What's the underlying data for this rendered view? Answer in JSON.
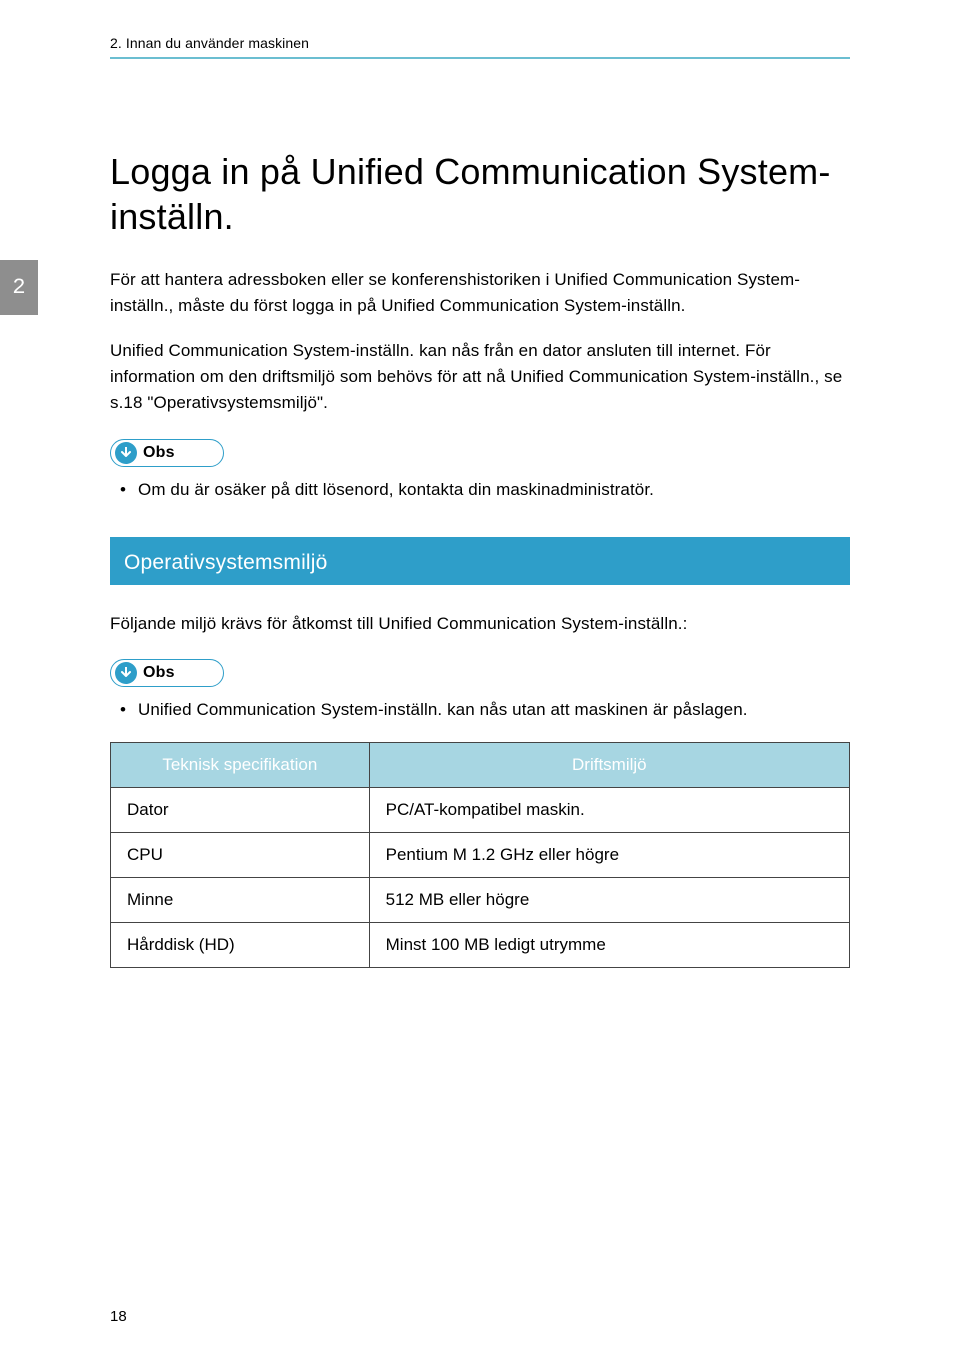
{
  "running_header": "2. Innan du använder maskinen",
  "side_tab": "2",
  "title": "Logga in på Unified Communication System-inställn.",
  "paragraph1": "För att hantera adressboken eller se konferenshistoriken i Unified Communication System-inställn., måste du först logga in på Unified Communication System-inställn.",
  "paragraph2": "Unified Communication System-inställn. kan nås från en dator ansluten till internet. För information om den driftsmiljö som behövs för att nå Unified Communication System-inställn., se s.18 \"Operativsystemsmiljö\".",
  "obs_label": "Obs",
  "note1": "Om du är osäker på ditt lösenord, kontakta din maskinadministratör.",
  "section_heading": "Operativsystemsmiljö",
  "paragraph3": "Följande miljö krävs för åtkomst till Unified Communication System-inställn.:",
  "note2": "Unified Communication System-inställn. kan nås utan att maskinen är påslagen.",
  "table": {
    "header_col1": "Teknisk specifikation",
    "header_col2": "Driftsmiljö",
    "rows": [
      {
        "spec": "Dator",
        "env": "PC/AT-kompatibel maskin."
      },
      {
        "spec": "CPU",
        "env": "Pentium M 1.2 GHz eller högre"
      },
      {
        "spec": "Minne",
        "env": "512 MB eller högre"
      },
      {
        "spec": "Hårddisk (HD)",
        "env": "Minst 100 MB ledigt utrymme"
      }
    ]
  },
  "page_number": "18"
}
